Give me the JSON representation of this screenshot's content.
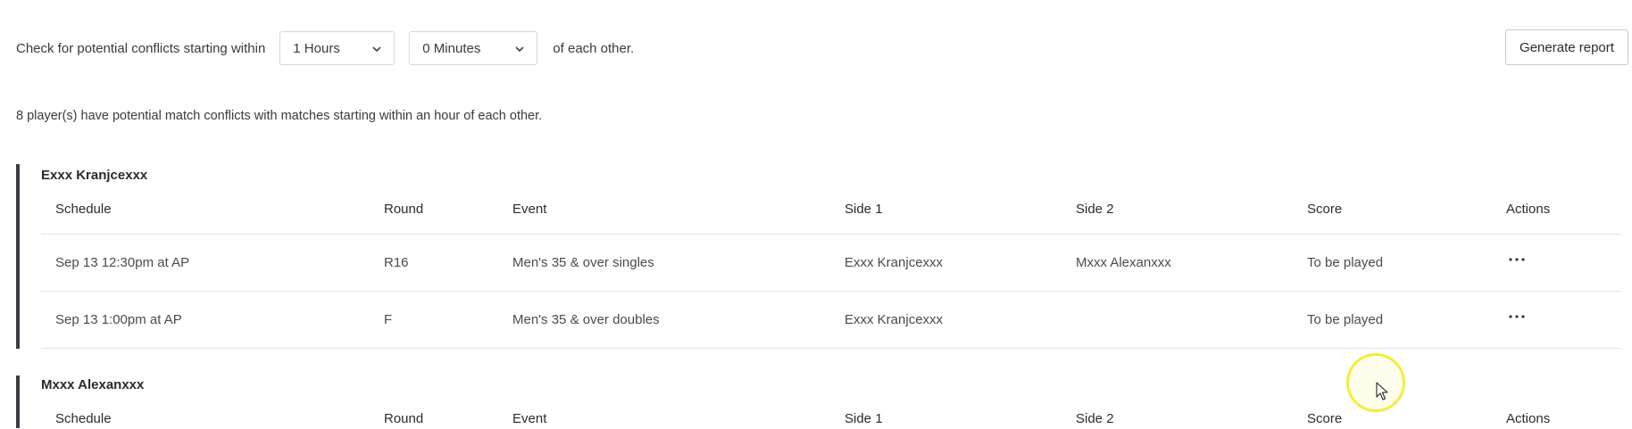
{
  "filters": {
    "prefix": "Check for potential conflicts starting within",
    "hours_value": "1 Hours",
    "minutes_value": "0 Minutes",
    "suffix": "of each other."
  },
  "generate_button": "Generate report",
  "summary": "8 player(s) have potential match conflicts with matches starting within an hour of each other.",
  "columns": [
    "Schedule",
    "Round",
    "Event",
    "Side 1",
    "Side 2",
    "Score",
    "Actions"
  ],
  "groups": [
    {
      "player": "Exxx Kranjcexxx",
      "rows": [
        {
          "schedule": "Sep 13 12:30pm at AP",
          "round": "R16",
          "event": "Men's 35 & over singles",
          "side1": "Exxx Kranjcexxx",
          "side2": "Mxxx Alexanxxx",
          "score": "To be played"
        },
        {
          "schedule": "Sep 13 1:00pm at AP",
          "round": "F",
          "event": "Men's 35 & over doubles",
          "side1": "Exxx Kranjcexxx",
          "side2": "",
          "score": "To be played"
        }
      ]
    },
    {
      "player": "Mxxx Alexanxxx",
      "rows": []
    }
  ],
  "icons": {
    "dropdown": "chevron-down-icon",
    "actions": "more-horizontal-icon",
    "pointer": "mouse-pointer-icon"
  },
  "colors": {
    "group_bar": "#3b3b47",
    "cursor_highlight": "#f4ec3a",
    "divider": "#e3e3e3"
  }
}
